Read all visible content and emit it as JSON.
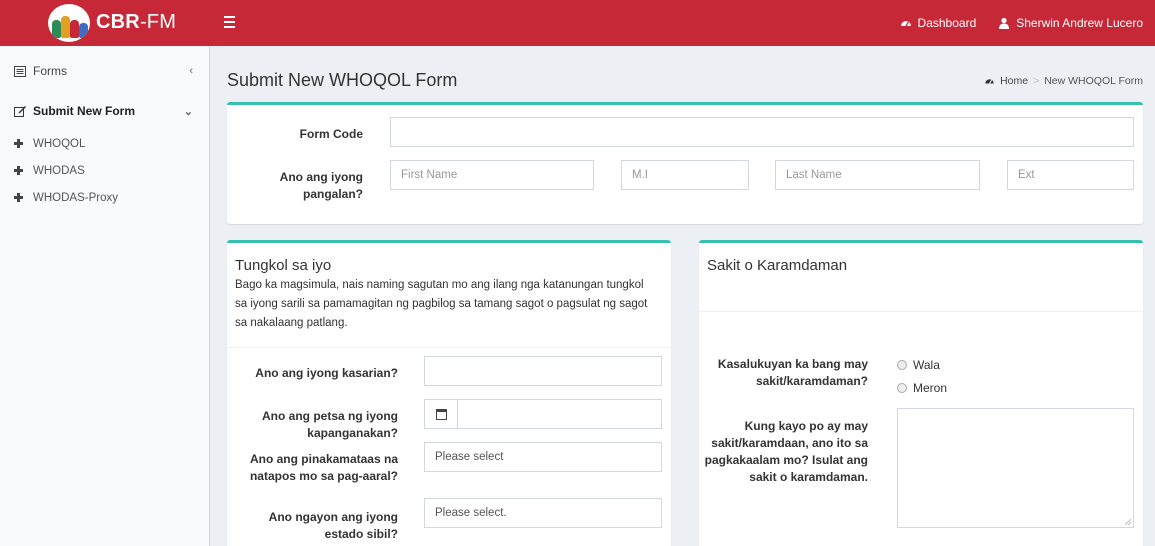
{
  "app": {
    "brand_bold": "CBR",
    "brand_rest": "-FM"
  },
  "topnav": {
    "dashboard": "Dashboard",
    "user": "Sherwin Andrew Lucero"
  },
  "sidebar": {
    "forms": "Forms",
    "submit_new_form": "Submit New Form",
    "items": [
      {
        "label": "WHOQOL"
      },
      {
        "label": "WHODAS"
      },
      {
        "label": "WHODAS-Proxy"
      }
    ]
  },
  "page": {
    "title": "Submit New WHOQOL Form",
    "breadcrumb_home": "Home",
    "breadcrumb_current": "New WHOQOL Form"
  },
  "top_form": {
    "form_code_label": "Form Code",
    "form_code_value": "",
    "name_label_line1": "Ano ang iyong",
    "name_label_line2": "pangalan?",
    "first_name_placeholder": "First Name",
    "mi_placeholder": "M.I",
    "last_name_placeholder": "Last Name",
    "ext_placeholder": "Ext"
  },
  "about": {
    "title": "Tungkol sa iyo",
    "desc_line1": "Bago ka magsimula, nais naming sagutan mo ang ilang nga katanungan tungkol",
    "desc_line2": "sa iyong sarili sa pamamagitan ng pagbilog sa tamang sagot o pagsulat ng sagot",
    "desc_line3": "sa nakalaang patlang.",
    "gender_label": "Ano ang iyong kasarian?",
    "birthdate_label_line1": "Ano ang petsa ng iyong",
    "birthdate_label_line2": "kapanganakan?",
    "education_label_line1": "Ano ang pinakamataas na",
    "education_label_line2": "natapos mo sa pag-aaral?",
    "education_value": "Please select",
    "civil_label_line1": "Ano ngayon ang iyong",
    "civil_label_line2": "estado sibil?",
    "civil_value": "Please select."
  },
  "illness": {
    "title": "Sakit o Karamdaman",
    "q1_line1": "Kasalukuyan ka bang may",
    "q1_line2": "sakit/karamdaman?",
    "opt_wala": "Wala",
    "opt_meron": "Meron",
    "q2_line1": "Kung kayo po ay may",
    "q2_line2": "sakit/karamdaan, ano ito sa",
    "q2_line3": "pagkakaalam mo? Isulat ang",
    "q2_line4": "sakit o karamdaman."
  },
  "colors": {
    "header_red": "#c62838",
    "box_accent": "#37c0b0"
  }
}
